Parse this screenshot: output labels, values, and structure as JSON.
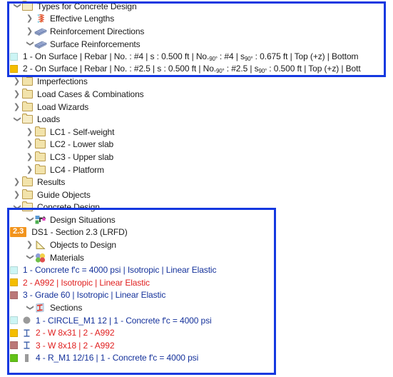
{
  "colors": {
    "highlight_border": "#1438e0",
    "folder_fill": "#f2e3ab",
    "folder_stroke": "#b99a4c",
    "badge_orange": "#f2941e",
    "text_blue": "#15329b",
    "text_red": "#e02020",
    "text_dark": "#1a1a1a",
    "swatch_cyan": "#ccf5f5",
    "swatch_yellow": "#f5bd00",
    "swatch_rose": "#bb7878",
    "swatch_green": "#62c217"
  },
  "tree": {
    "types_for_concrete_design": {
      "label": "Types for Concrete Design",
      "arrow": "expanded",
      "icon": "folder-open-icon",
      "children": {
        "effective_lengths": {
          "label": "Effective Lengths",
          "arrow": "collapsed",
          "icon": "effective-lengths-icon"
        },
        "reinforcement_directions": {
          "label": "Reinforcement Directions",
          "arrow": "collapsed",
          "icon": "reinforcement-directions-icon"
        },
        "surface_reinforcements": {
          "label": "Surface Reinforcements",
          "arrow": "expanded",
          "icon": "surface-reinforcements-icon",
          "items": [
            {
              "swatch": "#ccf5f5",
              "prefix": "1 - On Surface | Rebar | No. : #4 | s : 0.500 ft | No.",
              "sub1": "90°",
              "mid": " : #4 | s",
              "sub2": "90°",
              "suffix": " : 0.675 ft | Top (+z) | Bottom"
            },
            {
              "swatch": "#f5bd00",
              "prefix": "2 - On Surface | Rebar | No. : #2.5 | s : 0.500 ft | No.",
              "sub1": "90°",
              "mid": " : #2.5 | s",
              "sub2": "90°",
              "suffix": " : 0.500 ft | Top (+z) | Bott"
            }
          ]
        }
      }
    },
    "top_level_items": [
      {
        "label": "Imperfections",
        "arrow": "collapsed",
        "icon": "folder-icon"
      },
      {
        "label": "Load Cases & Combinations",
        "arrow": "collapsed",
        "icon": "folder-icon"
      },
      {
        "label": "Load Wizards",
        "arrow": "collapsed",
        "icon": "folder-icon"
      },
      {
        "label": "Loads",
        "arrow": "expanded",
        "icon": "folder-open-icon"
      }
    ],
    "load_cases": [
      {
        "label": "LC1 - Self-weight",
        "arrow": "collapsed",
        "icon": "folder-icon"
      },
      {
        "label": "LC2 - Lower slab",
        "arrow": "collapsed",
        "icon": "folder-icon"
      },
      {
        "label": "LC3 - Upper slab",
        "arrow": "collapsed",
        "icon": "folder-icon"
      },
      {
        "label": "LC4 - Platform",
        "arrow": "collapsed",
        "icon": "folder-icon"
      }
    ],
    "after_loads": [
      {
        "label": "Results",
        "arrow": "collapsed",
        "icon": "folder-icon"
      },
      {
        "label": "Guide Objects",
        "arrow": "collapsed",
        "icon": "folder-icon"
      }
    ],
    "concrete_design": {
      "label": "Concrete Design",
      "arrow": "expanded",
      "icon": "folder-open-icon",
      "design_situations": {
        "label": "Design Situations",
        "arrow": "expanded",
        "icon": "design-situations-icon",
        "item": {
          "badge": "2.3",
          "label": "DS1 - Section 2.3 (LRFD)"
        }
      },
      "objects_to_design": {
        "label": "Objects to Design",
        "arrow": "collapsed",
        "icon": "objects-to-design-icon"
      },
      "materials": {
        "label": "Materials",
        "arrow": "expanded",
        "icon": "materials-icon",
        "items": [
          {
            "swatch": "#ccf5f5",
            "label": "1 - Concrete f'c = 4000 psi | Isotropic | Linear Elastic",
            "color": "blue"
          },
          {
            "swatch": "#f5bd00",
            "label": "2 - A992 | Isotropic | Linear Elastic",
            "color": "red"
          },
          {
            "swatch": "#bb7878",
            "label": "3 - Grade 60 | Isotropic | Linear Elastic",
            "color": "blue"
          }
        ]
      },
      "sections": {
        "label": "Sections",
        "arrow": "expanded",
        "icon": "sections-icon",
        "items": [
          {
            "swatch": "#ccf5f5",
            "shape": "circle-section-icon",
            "label": "1 - CIRCLE_M1 12 | 1 - Concrete f'c = 4000 psi",
            "color": "blue"
          },
          {
            "swatch": "#f5bd00",
            "shape": "i-beam-section-icon",
            "label": "2 - W 8x31 | 2 - A992",
            "color": "red"
          },
          {
            "swatch": "#bb7878",
            "shape": "i-beam-section-icon",
            "label": "3 - W 8x18 | 2 - A992",
            "color": "red"
          },
          {
            "swatch": "#62c217",
            "shape": "rect-section-icon",
            "label": "4 - R_M1 12/16 | 1 - Concrete f'c = 4000 psi",
            "color": "blue"
          }
        ]
      }
    }
  }
}
